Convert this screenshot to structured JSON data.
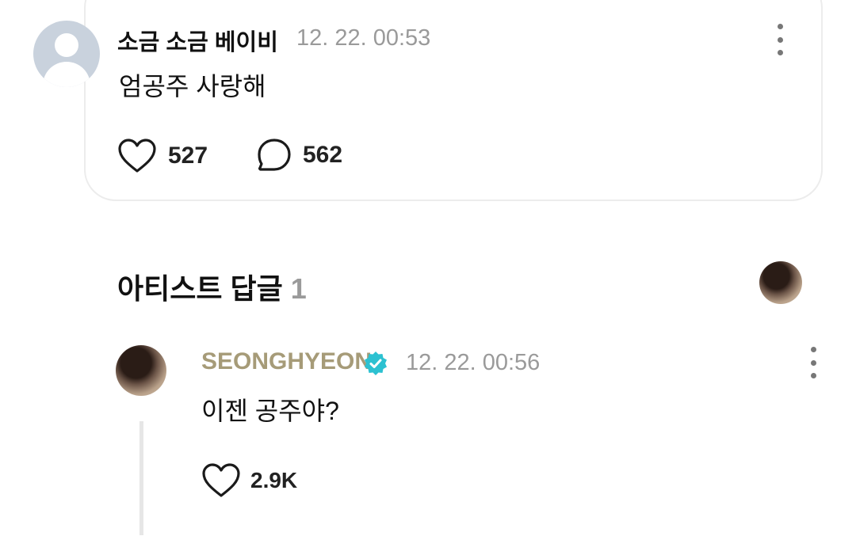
{
  "comment": {
    "author": "소금 소금 베이비",
    "timestamp": "12. 22. 00:53",
    "text": "엄공주 사랑해",
    "like_count": "527",
    "reply_count": "562"
  },
  "artist_replies": {
    "title": "아티스트 답글",
    "count": "1"
  },
  "reply": {
    "author": "SEONGHYEON",
    "timestamp": "12. 22. 00:56",
    "text": "이젠 공주야?",
    "like_count": "2.9K"
  },
  "colors": {
    "artist_name": "#a69b78",
    "verified_badge": "#2cc1d1",
    "timestamp": "#9a9a9a"
  },
  "icons": {
    "more": "more-vertical-icon",
    "like": "heart-outline-icon",
    "reply": "speech-bubble-icon",
    "verified": "verified-badge-icon"
  }
}
